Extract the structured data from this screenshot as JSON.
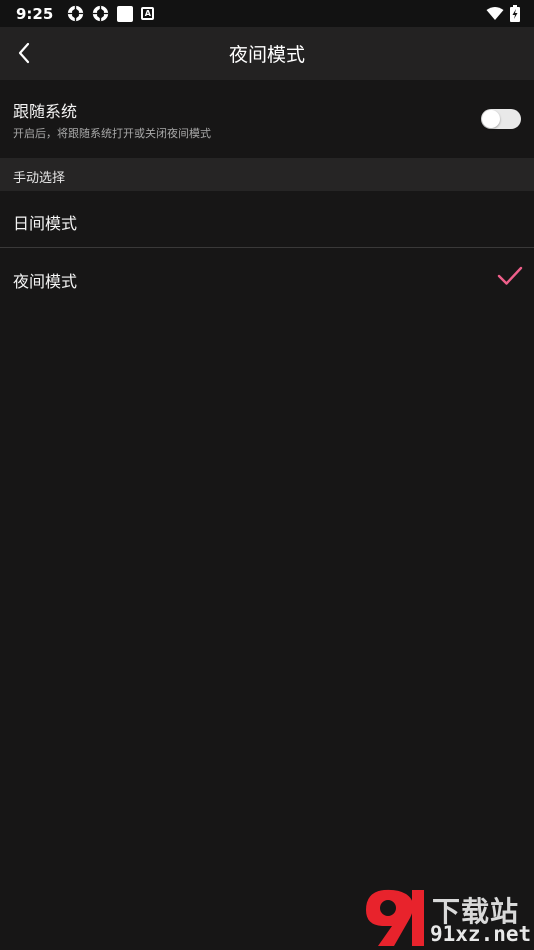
{
  "status_bar": {
    "time": "9:25",
    "left_icons": [
      "aperture-icon",
      "aperture-icon",
      "square-notification-icon",
      "a-notification-icon"
    ],
    "a_icon_letter": "A",
    "right_icons": [
      "wifi-icon",
      "battery-charging-icon"
    ]
  },
  "header": {
    "title": "夜间模式",
    "back_icon": "chevron-left-icon"
  },
  "follow_system": {
    "title": "跟随系统",
    "description": "开启后，将跟随系统打开或关闭夜间模式",
    "enabled": false
  },
  "manual_section": {
    "label": "手动选择"
  },
  "options": [
    {
      "label": "日间模式",
      "selected": false
    },
    {
      "label": "夜间模式",
      "selected": true
    }
  ],
  "watermark": {
    "mark": "9",
    "top_text": "下载站",
    "bottom_text": "91xz.net"
  },
  "colors": {
    "background": "#171616",
    "header": "#232222",
    "section": "#262525",
    "accent_check": "#ee5f8a",
    "watermark_red": "#e8232c"
  }
}
